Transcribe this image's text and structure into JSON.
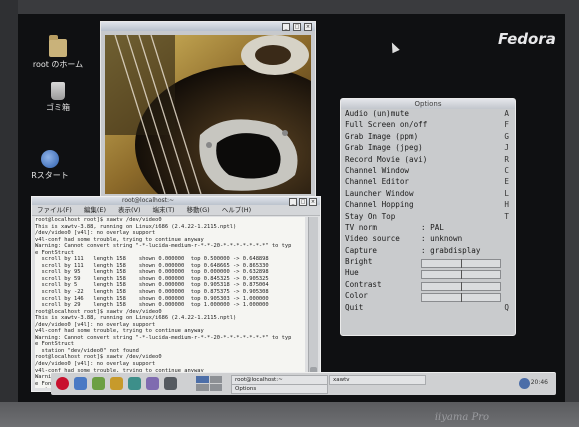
{
  "desktop": {
    "logo": "Fedora",
    "icons": [
      {
        "label": "root のホーム",
        "icon": "home-folder-icon"
      },
      {
        "label": "ゴミ箱",
        "icon": "trash-icon"
      },
      {
        "label": "Rスタート",
        "icon": "start-here-icon"
      }
    ]
  },
  "options_window": {
    "title": "Options",
    "items": [
      {
        "label": "Audio (un)mute",
        "key": "A"
      },
      {
        "label": "Full Screen on/off",
        "key": "F"
      },
      {
        "label": "Grab Image (ppm)",
        "key": "G"
      },
      {
        "label": "Grab Image (jpeg)",
        "key": "J"
      },
      {
        "label": "Record Movie (avi)",
        "key": "R"
      },
      {
        "label": "Channel Window",
        "key": "C"
      },
      {
        "label": "Channel Editor",
        "key": "E"
      },
      {
        "label": "Launcher Window",
        "key": "L"
      },
      {
        "label": "Channel Hopping",
        "key": "H"
      },
      {
        "label": "Stay On Top",
        "key": "T"
      }
    ],
    "settings": [
      {
        "label": "TV norm",
        "value": ": PAL"
      },
      {
        "label": "Video source",
        "value": ": unknown"
      },
      {
        "label": "Capture",
        "value": ": grabdisplay"
      }
    ],
    "sliders": [
      {
        "label": "Bright",
        "level": 0.5
      },
      {
        "label": "Hue",
        "level": 0.5
      },
      {
        "label": "Contrast",
        "level": 0.5
      },
      {
        "label": "Color",
        "level": 0.5
      }
    ],
    "quit": {
      "label": "Quit",
      "key": "Q"
    }
  },
  "terminal": {
    "title": "root@localhost:~",
    "menu": [
      "ファイル(F)",
      "編集(E)",
      "表示(V)",
      "端末(T)",
      "移動(G)",
      "ヘルプ(H)"
    ],
    "lines": [
      "root@localhost root]$ xawtv /dev/video0",
      "This is xawtv-3.88, running on Linux/i686 (2.4.22-1.2115.nptl)",
      "/dev/video0 [v4l]: no overlay support",
      "v4l-conf had some trouble, trying to continue anyway",
      "Warning: Cannot convert string \"-*-lucida-medium-r-*-*-20-*-*-*-*-*-*-*\" to typ",
      "e FontStruct",
      "  scroll by 111   length 158    shown 0.000000  top 0.500000 -> 0.648898",
      "  scroll by 111   length 158    shown 0.000000  top 0.648665 -> 0.865330",
      "  scroll by 95    length 158    shown 0.000000  top 0.000000 -> 0.632898",
      "  scroll by 59    length 158    shown 0.000000  top 0.845325 -> 0.905325",
      "  scroll by 5     length 158    shown 0.000000  top 0.905318 -> 0.875004",
      "  scroll by -22   length 158    shown 0.000000  top 0.875375 -> 0.905308",
      "  scroll by 146   length 158    shown 0.000000  top 0.905303 -> 1.000000",
      "  scroll by 29    length 158    shown 0.000000  top 1.000000 -> 1.000000",
      "root@localhost root]$ xawtv /dev/video0",
      "This is xawtv-3.88, running on Linux/i686 (2.4.22-1.2115.nptl)",
      "/dev/video0 [v4l]: no overlay support",
      "v4l-conf had some trouble, trying to continue anyway",
      "Warning: Cannot convert string \"-*-lucida-medium-r-*-*-20-*-*-*-*-*-*-*\" to typ",
      "e FontStruct",
      "  station \"dev/video0\" not found",
      "root@localhost root]$ xawtv /dev/video0",
      "/dev/video0 [v4l]: no overlay support",
      "v4l-conf had some trouble, trying to continue anyway",
      "Warning: Cannot convert string \"-*-lucida-medium-r-*-*-20-*-*-*-*-*-*-*\" to typ",
      "e FontStruct",
      "  station \"dev/video0\" not found",
      "call: VIDIOCSFREQ(f=0): 無効な引数です"
    ]
  },
  "taskbar": {
    "tasks": [
      {
        "label": "root@localhost:~"
      },
      {
        "label": "xawtv"
      },
      {
        "label": "Options"
      }
    ],
    "clock": "20:46"
  },
  "monitor": {
    "brand": "iiyama Pro"
  }
}
